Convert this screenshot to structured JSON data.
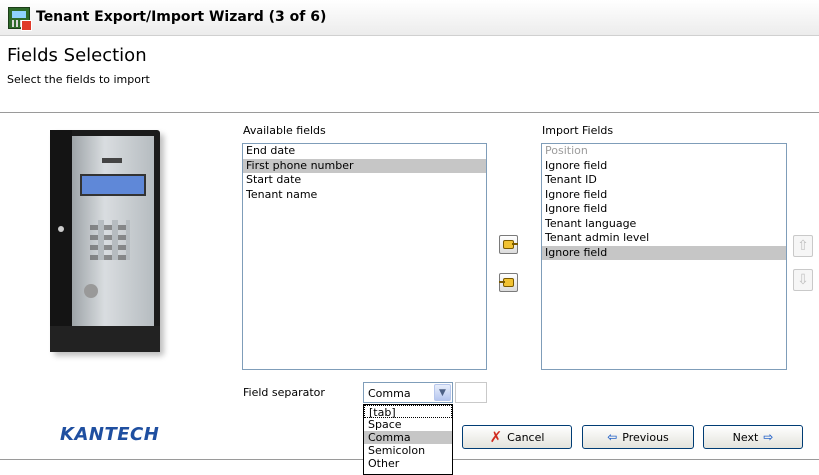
{
  "window": {
    "title": "Tenant Export/Import Wizard (3 of 6)"
  },
  "header": {
    "title": "Fields Selection",
    "subtitle": "Select the fields to import"
  },
  "available": {
    "label": "Available fields",
    "items": [
      "End date",
      "First phone number",
      "Start date",
      "Tenant name"
    ],
    "selected_index": 1
  },
  "import": {
    "label": "Import Fields",
    "items": [
      "Position",
      "Ignore field",
      "Tenant ID",
      "Ignore field",
      "Ignore field",
      "Tenant language",
      "Tenant admin level",
      "Ignore field"
    ],
    "selected_index": 7
  },
  "separator": {
    "label": "Field separator",
    "value": "Comma",
    "options": [
      "[tab]",
      "Space",
      "Comma",
      "Semicolon",
      "Other"
    ]
  },
  "buttons": {
    "cancel": "Cancel",
    "previous": "Previous",
    "next": "Next"
  },
  "brand": {
    "logo_text": "KANTECH"
  },
  "icons": {
    "move_right": "hand-right-icon",
    "move_left": "hand-left-icon",
    "move_up": "arrow-up-icon",
    "move_down": "arrow-down-icon"
  },
  "colors": {
    "selection": "#c6c6c6",
    "logo": "#1f4fa0",
    "cancel_x": "#d12b1f",
    "nav_arrow": "#2a66c9"
  }
}
